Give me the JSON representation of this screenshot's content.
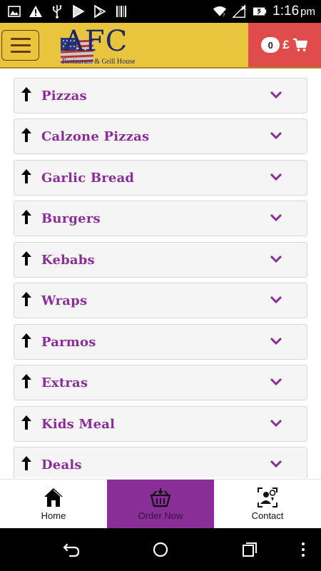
{
  "status_bar": {
    "time": "1:16",
    "ampm": "pm",
    "left_icons": [
      "image-icon",
      "warning-icon",
      "usb-icon",
      "play-outline-icon",
      "play-store-icon",
      "barcode-icon"
    ],
    "right_icons": [
      "wifi-icon",
      "no-signal-icon",
      "battery-icon"
    ]
  },
  "header": {
    "logo_text": "AFC",
    "logo_subtitle": "Restaurant & Grill House",
    "cart_count": "0",
    "cart_currency": "£",
    "colors": {
      "header_bg": "#e9c53d",
      "cart_bg": "#e04b4b",
      "accent": "#8a2e97"
    }
  },
  "categories": [
    {
      "label": "Pizzas"
    },
    {
      "label": "Calzone Pizzas"
    },
    {
      "label": "Garlic Bread"
    },
    {
      "label": "Burgers"
    },
    {
      "label": "Kebabs"
    },
    {
      "label": "Wraps"
    },
    {
      "label": "Parmos"
    },
    {
      "label": "Extras"
    },
    {
      "label": "Kids Meal"
    },
    {
      "label": "Deals"
    }
  ],
  "bottom_nav": {
    "items": [
      {
        "label": "Home",
        "icon": "home-icon"
      },
      {
        "label": "Order Now",
        "icon": "basket-icon",
        "active": true
      },
      {
        "label": "Contact",
        "icon": "contact-icon"
      }
    ]
  },
  "android_nav": {
    "icons": [
      "back-icon",
      "home-circle-icon",
      "recents-icon",
      "overflow-icon"
    ]
  }
}
